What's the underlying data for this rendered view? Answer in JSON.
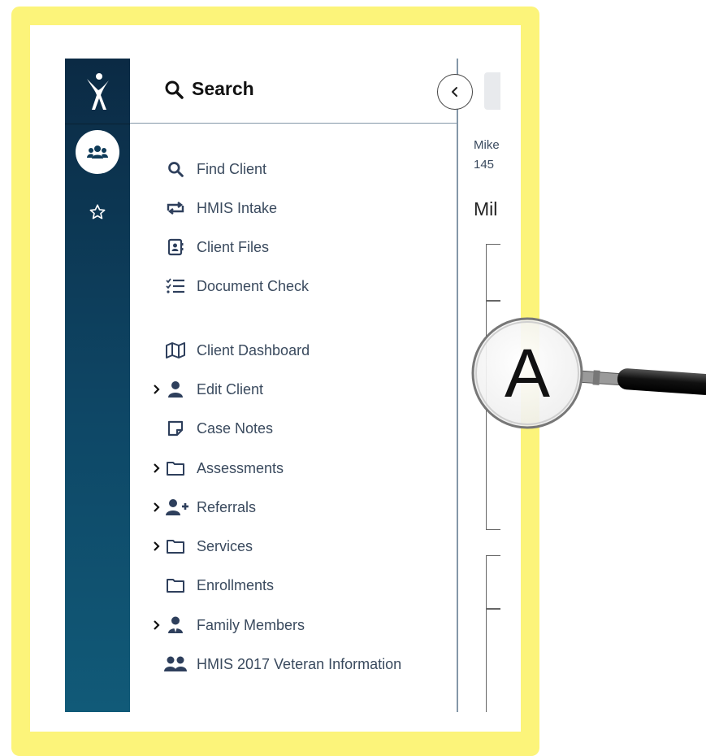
{
  "header": {
    "title": "Search"
  },
  "menu": [
    {
      "label": "Find Client",
      "icon": "search-icon",
      "has_chevron": false
    },
    {
      "label": "HMIS Intake",
      "icon": "repeat-icon",
      "has_chevron": false
    },
    {
      "label": "Client Files",
      "icon": "contact-file-icon",
      "has_chevron": false
    },
    {
      "label": "Document Check",
      "icon": "checklist-icon",
      "has_chevron": false
    },
    {
      "label": "Client Dashboard",
      "icon": "map-icon",
      "has_chevron": false
    },
    {
      "label": "Edit Client",
      "icon": "user-icon",
      "has_chevron": true
    },
    {
      "label": "Case Notes",
      "icon": "note-icon",
      "has_chevron": false
    },
    {
      "label": "Assessments",
      "icon": "folder-icon",
      "has_chevron": true
    },
    {
      "label": "Referrals",
      "icon": "user-plus-icon",
      "has_chevron": true
    },
    {
      "label": "Services",
      "icon": "folder-icon",
      "has_chevron": true
    },
    {
      "label": "Enrollments",
      "icon": "folder-icon",
      "has_chevron": false
    },
    {
      "label": "Family Members",
      "icon": "user-tie-icon",
      "has_chevron": true
    },
    {
      "label": "HMIS 2017 Veteran Information",
      "icon": "users-icon",
      "has_chevron": false
    }
  ],
  "client_panel": {
    "name_fragment": "Mike",
    "id_fragment": "145",
    "title_fragment": "Mil"
  },
  "annotation": {
    "letter": "A"
  },
  "colors": {
    "rail_dark": "#0b2a44",
    "rail_light": "#115a78",
    "icon": "#2e3f5c",
    "text": "#3a4a5e",
    "highlight": "#fcf47a"
  }
}
